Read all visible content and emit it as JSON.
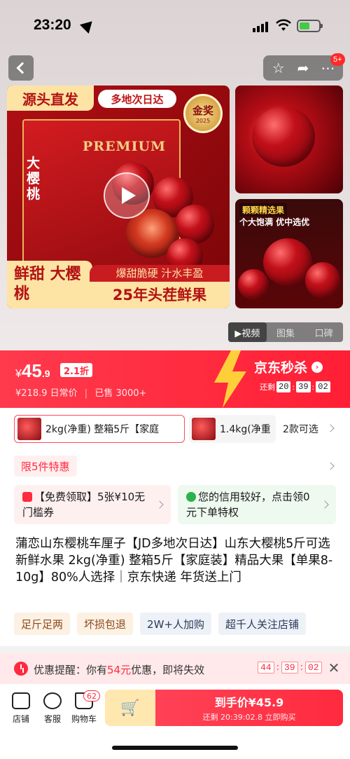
{
  "status_bar": {
    "time": "23:20"
  },
  "header": {
    "more_count": "5+",
    "icons": [
      "back-icon",
      "star-icon",
      "share-icon",
      "more-icon"
    ]
  },
  "gallery": {
    "main": {
      "tag_left": "源头直发",
      "tag_delivery": "多地次日达",
      "box_brand": "PREMIUM",
      "box_vertical": "大樱桃",
      "medal_title": "金奖",
      "medal_sub": "2025",
      "promo_left": "鲜甜 大樱桃",
      "promo_right_top": "爆甜脆硬 汁水丰盈",
      "promo_right_bottom": "25年头茬鲜果"
    },
    "side2_line1": "颗颗精选果",
    "side2_line2": "个大饱满 优中选优",
    "tabs": [
      "▶视频",
      "图集",
      "口碑"
    ]
  },
  "price": {
    "currency": "¥",
    "integer": "45",
    "decimal": ".9",
    "discount": "2.1折",
    "original": "¥218.9",
    "original_label": "日常价",
    "sold": "已售 3000+",
    "seckill_label": "京东秒杀",
    "countdown_label": "还剩",
    "countdown": [
      "20",
      "39",
      "02"
    ]
  },
  "variants": {
    "items": [
      "2kg(净重) 整箱5斤【家庭",
      "1.4kg(净重"
    ],
    "count_label": "2款可选"
  },
  "limit_tag": "限5件特惠",
  "coupons": {
    "left": "【免费领取】5张¥10无门槛券",
    "right": "您的信用较好，点击领0元下单特权"
  },
  "title": "蒲恋山东樱桃车厘子【JD多地次日达】山东大樱桃5斤可选新鲜水果 2kg(净重) 整箱5斤【家庭装】精品大果【单果8-10g】80%人选择｜京东快递 年货送上门",
  "tags": [
    "足斤足两",
    "坏损包退",
    "2W+人加购",
    "超千人关注店铺"
  ],
  "reminder": {
    "prefix": "优惠提醒：你有",
    "amount": "54元",
    "suffix": "优惠，即将失效",
    "timer": [
      "44",
      "39",
      "02"
    ]
  },
  "bottom_nav": {
    "items": [
      "店铺",
      "客服",
      "购物车"
    ],
    "cart_count": "62",
    "buy_label": "到手价¥45.9",
    "buy_sub": "还剩 20:39:02.8 立即购买"
  },
  "colors": {
    "accent": "#ff2a3e",
    "gold": "#fde3a4"
  }
}
